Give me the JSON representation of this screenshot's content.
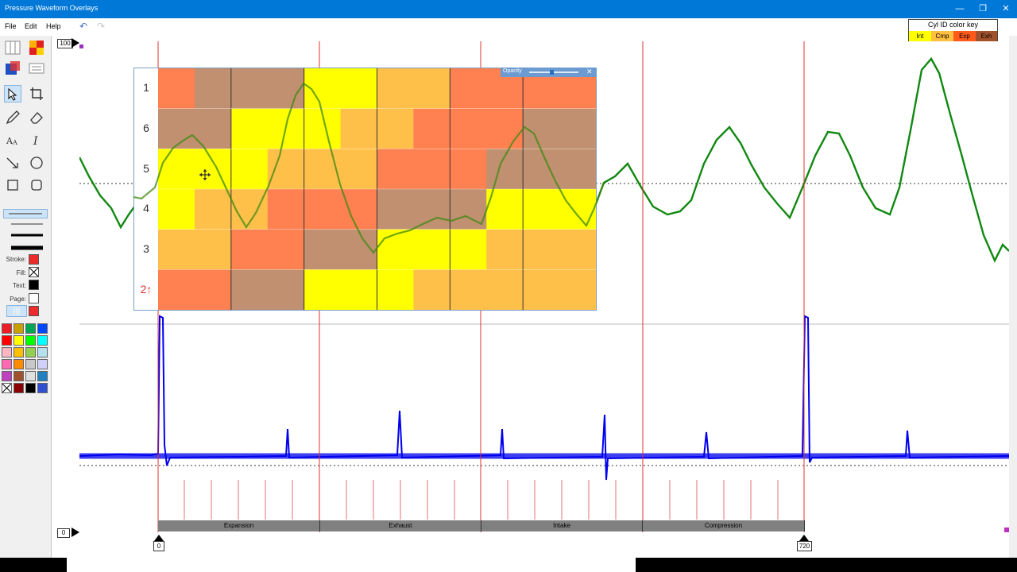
{
  "app": {
    "title": "Pressure Waveform Overlays"
  },
  "window_buttons": {
    "minimize": "—",
    "restore": "❐",
    "close": "✕"
  },
  "menu": {
    "file": "File",
    "edit": "Edit",
    "help": "Help"
  },
  "toolbar": {
    "stroke_label": "Stroke:",
    "fill_label": "Fill:",
    "text_label": "Text:",
    "page_label": "Page:",
    "stroke_color": "#ee2a2a",
    "text_color": "#000000",
    "page_color": "#ffffff",
    "palette": [
      [
        "#ee1c24",
        "#c8a000",
        "#00a651",
        "#0047ff"
      ],
      [
        "#ff0000",
        "#ffff00",
        "#00ff00",
        "#00ffff"
      ],
      [
        "#ffb6c1",
        "#ffc000",
        "#92d050",
        "#b4e0f0"
      ],
      [
        "#ff69b4",
        "#ff8c00",
        "#c8c8c8",
        "#d0d0f8"
      ],
      [
        "#c040c0",
        "#a0522d",
        "#e0e0e0",
        "#2080c0"
      ],
      [
        "none",
        "#8b0000",
        "#000000",
        "#3050d0"
      ]
    ]
  },
  "color_key": {
    "title": "Cyl ID color key",
    "items": [
      {
        "label": "Int",
        "color": "#ffff00"
      },
      {
        "label": "Cmp",
        "color": "#ffbf40"
      },
      {
        "label": "Exp",
        "color": "#ff5a1a"
      },
      {
        "label": "Exh",
        "color": "#a0522d"
      }
    ]
  },
  "overlay": {
    "opacity_label": "Opacity",
    "close": "✕",
    "row_labels": [
      "1",
      "6",
      "5",
      "4",
      "3",
      "2↑"
    ],
    "legend_colors": {
      "int": "#ffff00",
      "cmp": "#ffc04a",
      "exp": "#ff8050",
      "exh": "#c09070"
    },
    "grid": [
      [
        "exp",
        "exh",
        "exh",
        "exh",
        "int",
        "int",
        "cmp",
        "cmp",
        "exp",
        "exp",
        "exp",
        "exp"
      ],
      [
        "exh",
        "exh",
        "int",
        "int",
        "int",
        "cmp",
        "cmp",
        "exp",
        "exp",
        "exp",
        "exh",
        "exh"
      ],
      [
        "int",
        "int",
        "int",
        "cmp",
        "cmp",
        "cmp",
        "exp",
        "exp",
        "exp",
        "exh",
        "exh",
        "exh"
      ],
      [
        "int",
        "cmp",
        "cmp",
        "exp",
        "exp",
        "exp",
        "exh",
        "exh",
        "exh",
        "int",
        "int",
        "int"
      ],
      [
        "cmp",
        "cmp",
        "exp",
        "exp",
        "exh",
        "exh",
        "int",
        "int",
        "int",
        "cmp",
        "cmp",
        "cmp"
      ],
      [
        "exp",
        "exp",
        "exh",
        "exh",
        "int",
        "int",
        "int",
        "cmp",
        "cmp",
        "cmp",
        "cmp",
        "cmp"
      ]
    ]
  },
  "markers": {
    "top_scale": "100",
    "bottom_scale": "0",
    "deg_start": "0",
    "deg_end": "720"
  },
  "phases": [
    "Expansion",
    "Exhaust",
    "Intake",
    "Compression"
  ]
}
